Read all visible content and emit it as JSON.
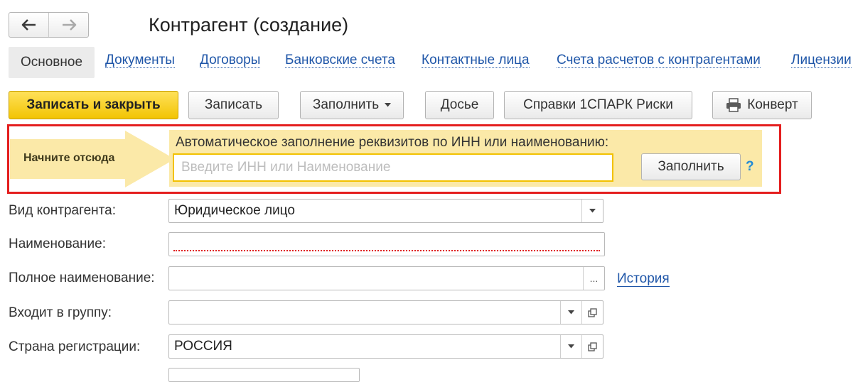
{
  "window": {
    "title": "Контрагент (создание)"
  },
  "nav": {
    "back_icon": "arrow-left-icon",
    "forward_icon": "arrow-right-icon"
  },
  "tabs": [
    {
      "label": "Основное",
      "active": true
    },
    {
      "label": "Документы"
    },
    {
      "label": "Договоры"
    },
    {
      "label": "Банковские счета"
    },
    {
      "label": "Контактные лица"
    },
    {
      "label": "Счета расчетов с контрагентами"
    },
    {
      "label": "Лицензии"
    }
  ],
  "toolbar": {
    "save_close": "Записать и закрыть",
    "save": "Записать",
    "fill": "Заполнить",
    "dossier": "Досье",
    "spark": "Справки 1СПАРК Риски",
    "envelope": "Конверт",
    "envelope_icon": "printer-icon"
  },
  "autofill": {
    "start_label": "Начните отсюда",
    "label": "Автоматическое заполнение реквизитов по ИНН или наименованию:",
    "placeholder": "Введите ИНН или Наименование",
    "button": "Заполнить",
    "help": "?"
  },
  "form": {
    "kind_label": "Вид контрагента:",
    "kind_value": "Юридическое лицо",
    "name_label": "Наименование:",
    "name_value": "",
    "full_name_label": "Полное наименование:",
    "full_name_value": "",
    "history_link": "История",
    "group_label": "Входит в группу:",
    "group_value": "",
    "country_label": "Страна регистрации:",
    "country_value": "РОССИЯ",
    "ellipsis": "..."
  },
  "colors": {
    "accent_yellow": "#f2c403",
    "highlight_panel": "#fbe9a8",
    "frame_red": "#e41e1e",
    "link_blue": "#1f56a8"
  }
}
